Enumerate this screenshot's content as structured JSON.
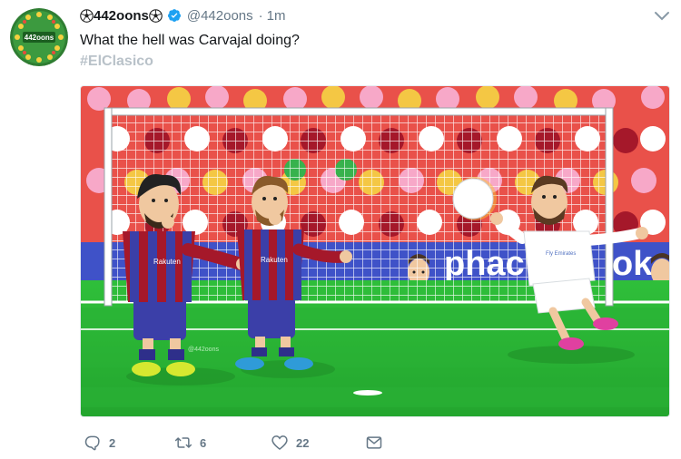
{
  "tweet": {
    "display_name": "442oons",
    "handle": "@442oons",
    "separator": "·",
    "time": "1m",
    "text": "What the hell was Carvajal doing?",
    "hashtag": "#ElClasico",
    "avatar_text": "442oons"
  },
  "media": {
    "banner_text_left": "phac",
    "banner_text_right": "ok",
    "shirt_sponsor": "Rakuten",
    "white_shirt_sponsor": "Fly Emirates",
    "pitch_watermark": "@442oons"
  },
  "actions": {
    "replies": "2",
    "retweets": "6",
    "likes": "22"
  },
  "icons": {
    "reply": "reply-icon",
    "retweet": "retweet-icon",
    "like": "heart-icon",
    "dm": "envelope-icon",
    "verified": "verified-badge-icon",
    "menu": "chevron-down-icon"
  },
  "colors": {
    "hashtag": "#b9c2c9",
    "verified": "#1da1f2",
    "muted": "#657786"
  }
}
